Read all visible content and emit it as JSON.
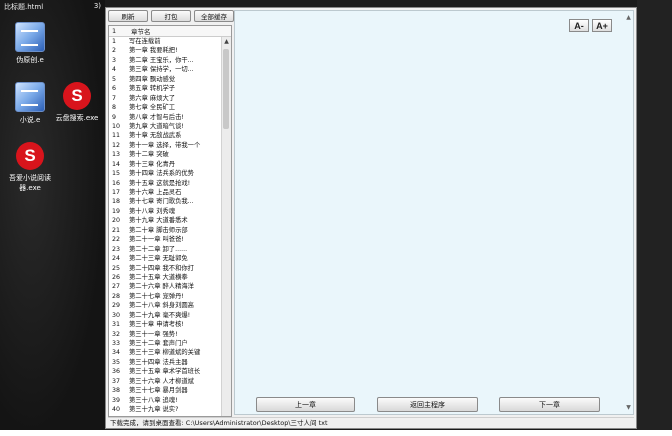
{
  "desktop": {
    "top_text": "比标题.html",
    "top_num": "3)",
    "icons": [
      {
        "label": "伪原创.e"
      },
      {
        "label": "小说.e"
      },
      {
        "label": "云盘搜索.exe"
      },
      {
        "label": "吾爱小说阅读器.exe"
      }
    ]
  },
  "toolbar": {
    "buttons": [
      "刷新",
      "打包",
      "全部缓存"
    ]
  },
  "list": {
    "col_index": "1",
    "col_title": "章节名",
    "rows": [
      {
        "n": "1",
        "t": "写在连载前"
      },
      {
        "n": "2",
        "t": "第一章 我要耗把!"
      },
      {
        "n": "3",
        "t": "第二章 王宝乐，你干..."
      },
      {
        "n": "4",
        "t": "第三章 保持学，一切..."
      },
      {
        "n": "5",
        "t": "第四章 飘动感觉"
      },
      {
        "n": "6",
        "t": "第五章 转机学子"
      },
      {
        "n": "7",
        "t": "第六章 麻烦大了"
      },
      {
        "n": "8",
        "t": "第七章 全民矿工"
      },
      {
        "n": "9",
        "t": "第八章 才智与后击!"
      },
      {
        "n": "10",
        "t": "第九章 大道暗气谈!"
      },
      {
        "n": "11",
        "t": "第十章 无敌战武系"
      },
      {
        "n": "12",
        "t": "第十一章 选择，带我一个"
      },
      {
        "n": "13",
        "t": "第十二章 突破"
      },
      {
        "n": "14",
        "t": "第十三章 化青丹"
      },
      {
        "n": "15",
        "t": "第十四章 法兵系的优势"
      },
      {
        "n": "16",
        "t": "第十五章 这就是抢戏!"
      },
      {
        "n": "17",
        "t": "第十六章 上品灵石"
      },
      {
        "n": "18",
        "t": "第十七章 寄门歌负我..."
      },
      {
        "n": "19",
        "t": "第十八章 刘秀魂"
      },
      {
        "n": "20",
        "t": "第十九章 大道番悉术"
      },
      {
        "n": "21",
        "t": "第二十章 脚击师示部"
      },
      {
        "n": "22",
        "t": "第二十一章 叫爸爸!"
      },
      {
        "n": "23",
        "t": "第二十二章 卸了......"
      },
      {
        "n": "24",
        "t": "第二十三章 无耻郭免"
      },
      {
        "n": "25",
        "t": "第二十四章 我不和你打"
      },
      {
        "n": "26",
        "t": "第二十五章 大道横拳"
      },
      {
        "n": "27",
        "t": "第二十六章 醉人精海洋"
      },
      {
        "n": "28",
        "t": "第二十七章 宠弹丹!"
      },
      {
        "n": "29",
        "t": "第二十八章 斜身刘圆高"
      },
      {
        "n": "30",
        "t": "第二十九章 毫不爽爆!"
      },
      {
        "n": "31",
        "t": "第三十章 申请考核!"
      },
      {
        "n": "32",
        "t": "第三十一章 强势!"
      },
      {
        "n": "33",
        "t": "第三十二章 套声门户"
      },
      {
        "n": "34",
        "t": "第三十三章 柳道斌的关键"
      },
      {
        "n": "35",
        "t": "第三十四章 法兵主器"
      },
      {
        "n": "36",
        "t": "第三十五章 章术学首班长"
      },
      {
        "n": "37",
        "t": "第三十六章 人才柳道斌"
      },
      {
        "n": "38",
        "t": "第三十七章 暴月剑器"
      },
      {
        "n": "39",
        "t": "第三十八章 追魂!"
      },
      {
        "n": "40",
        "t": "第三十九章 说实?"
      }
    ]
  },
  "reader": {
    "font_decrease": "A-",
    "font_increase": "A+",
    "prev": "上一章",
    "back": "返回主程序",
    "next": "下一章"
  },
  "status": {
    "text": "下载完成，请到桌面查看: C:\\Users\\Administrator\\Desktop\\三寸人间 txt"
  }
}
